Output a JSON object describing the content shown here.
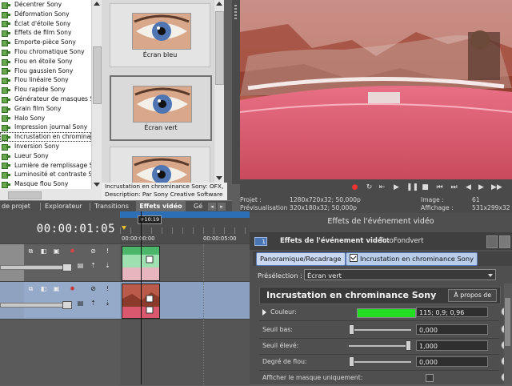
{
  "effects_list": {
    "items": [
      "Décentrer Sony",
      "Déformation Sony",
      "Éclat d'étoile Sony",
      "Effets de film Sony",
      "Emporte-pièce Sony",
      "Flou chromatique Sony",
      "Flou en étoile Sony",
      "Flou gaussien Sony",
      "Flou linéaire Sony",
      "Flou rapide Sony",
      "Générateur de masques So",
      "Grain film Sony",
      "Halo Sony",
      "Impression journal Sony",
      "Incrustation en chrominance",
      "Inversion Sony",
      "Lueur Sony",
      "Lumière de remplissage So",
      "Luminosité et contraste So",
      "Masque flou Sony"
    ],
    "selected_index": 14
  },
  "presets": {
    "items": [
      {
        "label": "Écran bleu"
      },
      {
        "label": "Écran vert"
      },
      {
        "label": ""
      }
    ]
  },
  "description": {
    "line1": "Incrustation en chrominance Sony: OFX,",
    "line2": "Description: Par Sony Creative Software"
  },
  "tabs": [
    {
      "label": "de projet"
    },
    {
      "label": "Explorateur"
    },
    {
      "label": "Transitions"
    },
    {
      "label": "Effets vidéo"
    },
    {
      "label": "Gé"
    }
  ],
  "transport_icons": [
    "record-icon",
    "loop-icon",
    "play-from-start-icon",
    "play-icon",
    "pause-icon",
    "stop-icon",
    "prev-frame-icon",
    "next-frame-icon",
    "prev-marker-icon",
    "next-marker-icon"
  ],
  "preview_info": {
    "projet_label": "Projet :",
    "projet_value": "1280x720x32; 50,000p",
    "preview_label": "Prévisualisation :",
    "preview_value": "320x180x32; 50,000p",
    "image_label": "Image :",
    "image_value": "61",
    "display_label": "Affichage :",
    "display_value": "531x299x32"
  },
  "timeline": {
    "timecode": "00:00:01:05",
    "cursor_label": "+10:19",
    "ruler_start": "00:00:00:00",
    "ruler_mark": "00:00:05:00"
  },
  "video_fx_panel": {
    "title": "Effets de l'événement vidéo",
    "event_label": "Effets de l'événement vidéo:",
    "event_name": "TutoFondvert",
    "chain": [
      "Panoramique/Recadrage",
      "Incrustation en chrominance Sony"
    ],
    "preset_label": "Présélection :",
    "preset_value": "Écran vert",
    "plugin_name": "Incrustation en chrominance Sony",
    "about_label": "À propos de",
    "params": {
      "color_label": "Couleur:",
      "color_value": "115; 0,9; 0,96",
      "seuil_bas_label": "Seuil bas:",
      "seuil_bas_value": "0,000",
      "seuil_eleve_label": "Seuil élevé:",
      "seuil_eleve_value": "1,000",
      "degre_label": "Degré de flou:",
      "degre_value": "0,000",
      "mask_label": "Afficher le masque uniquement:"
    },
    "color_swatch": "#22dd22",
    "seuil_bas_level": 0.0,
    "seuil_eleve_level": 1.0,
    "degre_level": 0.0
  },
  "colors": {
    "accent_blue": "#2d6fb7",
    "chain_selected": "#c9d8f0",
    "clip_green": "#4bb56a",
    "clip_red": "#c0392b"
  }
}
